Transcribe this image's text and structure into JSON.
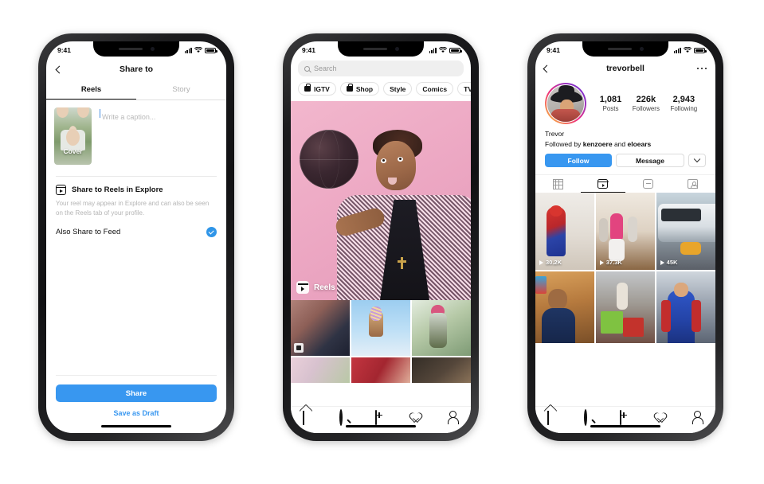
{
  "phones": [
    {
      "id": "share-to",
      "status_bar": {
        "time": "9:41",
        "signal": "signal-bars",
        "wifi": "wifi-icon",
        "battery": "battery-icon"
      },
      "nav": {
        "back_icon": "chevron-left-icon",
        "title": "Share to"
      },
      "tabs": [
        {
          "label": "Reels",
          "active": true
        },
        {
          "label": "Story",
          "active": false
        }
      ],
      "cover": {
        "label": "Cover"
      },
      "caption": {
        "placeholder": "Write a caption..."
      },
      "explore": {
        "icon": "reels-icon",
        "title": "Share to Reels in Explore",
        "description": "Your reel may appear in Explore and can also be seen on the Reels tab of your profile."
      },
      "feed_toggle": {
        "label": "Also Share to Feed",
        "checked": true,
        "color": "#2f95e8"
      },
      "primary_button": {
        "label": "Share",
        "color": "#3897f0"
      },
      "secondary_button": {
        "label": "Save as Draft",
        "color": "#3897f0"
      }
    },
    {
      "id": "explore",
      "status_bar": {
        "time": "9:41",
        "signal": "signal-bars",
        "wifi": "wifi-icon",
        "battery": "battery-icon"
      },
      "search": {
        "placeholder": "Search",
        "icon": "search-icon"
      },
      "chips": [
        {
          "label": "IGTV",
          "icon": "igtv-bag-icon"
        },
        {
          "label": "Shop",
          "icon": "shop-bag-icon"
        },
        {
          "label": "Style",
          "icon": null
        },
        {
          "label": "Comics",
          "icon": null
        },
        {
          "label": "TV & Movie",
          "icon": null
        }
      ],
      "hero": {
        "badge_label": "Reels",
        "badge_icon": "reels-icon",
        "background": "#eda9c4"
      },
      "grid": [
        {
          "name": "two-people-laptop",
          "color_a": "#b6837b",
          "color_b": "#3b3f52"
        },
        {
          "name": "glitter-hand-sky",
          "color_a": "#8fc6ee",
          "color_b": "#cfe6f7"
        },
        {
          "name": "person-pink-beanie",
          "color_a": "#9fb9a7",
          "color_b": "#dfe8d8"
        },
        {
          "name": "flowers",
          "color_a": "#e9cfd8",
          "color_b": "#cfd8bd"
        },
        {
          "name": "red-fabric",
          "color_a": "#b7323b",
          "color_b": "#e4b9a8"
        },
        {
          "name": "dark-portrait",
          "color_a": "#2e2a25",
          "color_b": "#6b5a45"
        }
      ],
      "tabbar": [
        {
          "icon": "home-icon",
          "active": false
        },
        {
          "icon": "search-icon",
          "active": true
        },
        {
          "icon": "add-post-icon",
          "active": false
        },
        {
          "icon": "heart-icon",
          "active": false
        },
        {
          "icon": "profile-icon",
          "active": false
        }
      ]
    },
    {
      "id": "profile",
      "status_bar": {
        "time": "9:41",
        "signal": "signal-bars",
        "wifi": "wifi-icon",
        "battery": "battery-icon"
      },
      "nav": {
        "back_icon": "chevron-left-icon",
        "title": "trevorbell",
        "more_icon": "more-options-icon"
      },
      "avatar": {
        "name": "profile-avatar",
        "has_story_ring": true
      },
      "stats": [
        {
          "number": "1,081",
          "label": "Posts"
        },
        {
          "number": "226k",
          "label": "Followers"
        },
        {
          "number": "2,943",
          "label": "Following"
        }
      ],
      "bio": {
        "display_name": "Trevor",
        "followed_by_prefix": "Followed by ",
        "followed_by_user1": "kenzoere",
        "followed_by_joiner": " and ",
        "followed_by_user2": "eloears"
      },
      "actions": {
        "follow_label": "Follow",
        "follow_color": "#3897f0",
        "message_label": "Message",
        "more_icon": "chevron-down-icon"
      },
      "content_tabs": [
        {
          "icon": "grid-icon",
          "active": false
        },
        {
          "icon": "reels-icon",
          "active": true
        },
        {
          "icon": "igtv-icon",
          "active": false
        },
        {
          "icon": "tagged-icon",
          "active": false
        }
      ],
      "reels_grid": [
        {
          "name": "spiderman-hallway",
          "views": "30.2K",
          "color_a": "#e8e3de",
          "color_b": "#c8bdb0"
        },
        {
          "name": "group-dance-workout",
          "views": "37.3K",
          "color_a": "#ded6cb",
          "color_b": "#8e6f50"
        },
        {
          "name": "city-bus-street",
          "views": "45K",
          "color_a": "#c9d3da",
          "color_b": "#55606a"
        },
        {
          "name": "person-navy-shirt",
          "views": null,
          "color_a": "#c08b52",
          "color_b": "#6c4a2c"
        },
        {
          "name": "gym-box-jump",
          "views": null,
          "color_a": "#b9bcc0",
          "color_b": "#6c4f46"
        },
        {
          "name": "superman-costume",
          "views": null,
          "color_a": "#3f63c4",
          "color_b": "#1d2a6b"
        }
      ],
      "tabbar": [
        {
          "icon": "home-icon",
          "active": false
        },
        {
          "icon": "search-icon",
          "active": true
        },
        {
          "icon": "add-post-icon",
          "active": false
        },
        {
          "icon": "heart-icon",
          "active": false
        },
        {
          "icon": "profile-icon",
          "active": false
        }
      ]
    }
  ]
}
